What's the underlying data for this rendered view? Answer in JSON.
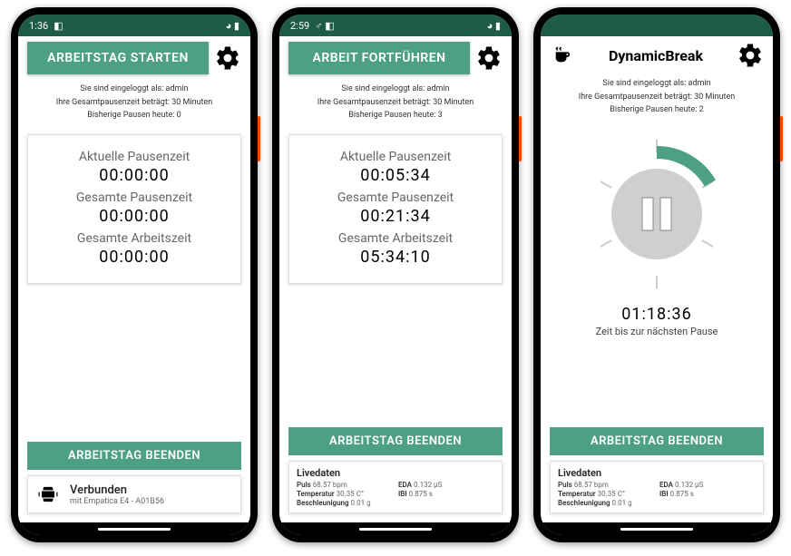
{
  "phones": [
    {
      "status": {
        "time": "1:36",
        "icons_left": "◧",
        "icons_right": "◕ ▮"
      },
      "header_button": "ARBEITSTAG STARTEN",
      "login_text": "Sie sind eingeloggt als: admin",
      "pause_info": "Ihre Gesamtpausenzeit beträgt: 30 Minuten",
      "pause_today": "Bisherige Pausen heute: 0",
      "stats": {
        "current_label": "Aktuelle Pausenzeit",
        "current_value": "00:00:00",
        "total_pause_label": "Gesamte Pausenzeit",
        "total_pause_value": "00:00:00",
        "total_work_label": "Gesamte Arbeitszeit",
        "total_work_value": "00:00:00"
      },
      "end_button": "ARBEITSTAG BEENDEN",
      "connected": {
        "title": "Verbunden",
        "sub": "mit Empatica E4 - A01B56"
      }
    },
    {
      "status": {
        "time": "2:59",
        "icons_left": "♂ ◧",
        "icons_right": "◕ ▮"
      },
      "header_button": "ARBEIT FORTFÜHREN",
      "login_text": "Sie sind eingeloggt als: admin",
      "pause_info": "Ihre Gesamtpausenzeit beträgt: 30 Minuten",
      "pause_today": "Bisherige Pausen heute: 3",
      "stats": {
        "current_label": "Aktuelle Pausenzeit",
        "current_value": "00:05:34",
        "total_pause_label": "Gesamte Pausenzeit",
        "total_pause_value": "00:21:34",
        "total_work_label": "Gesamte Arbeitszeit",
        "total_work_value": "05:34:10"
      },
      "end_button": "ARBEITSTAG BEENDEN",
      "livedata": {
        "title": "Livedaten",
        "pulse_label": "Puls",
        "pulse_value": "68.57 bpm",
        "eda_label": "EDA",
        "eda_value": "0.132 µS",
        "temp_label": "Temperatur",
        "temp_value": "30.35 C°",
        "ibi_label": "IBI",
        "ibi_value": "0.875 s",
        "accel_label": "Beschleunigung",
        "accel_value": "0.01 g"
      }
    },
    {
      "status": {
        "time": "",
        "icons_left": "",
        "icons_right": ""
      },
      "app_title": "DynamicBreak",
      "login_text": "Sie sind eingeloggt als: admin",
      "pause_info": "Ihre Gesamtpausenzeit beträgt: 30 Minuten",
      "pause_today": "Bisherige Pausen heute: 2",
      "countdown": {
        "time": "01:18:36",
        "label": "Zeit bis zur nächsten Pause"
      },
      "end_button": "ARBEITSTAG BEENDEN",
      "livedata": {
        "title": "Livedaten",
        "pulse_label": "Puls",
        "pulse_value": "68.57 bpm",
        "eda_label": "EDA",
        "eda_value": "0.132 µS",
        "temp_label": "Temperatur",
        "temp_value": "30.35 C°",
        "ibi_label": "IBI",
        "ibi_value": "0.875 s",
        "accel_label": "Beschleunigung",
        "accel_value": "0.01 g"
      }
    }
  ]
}
